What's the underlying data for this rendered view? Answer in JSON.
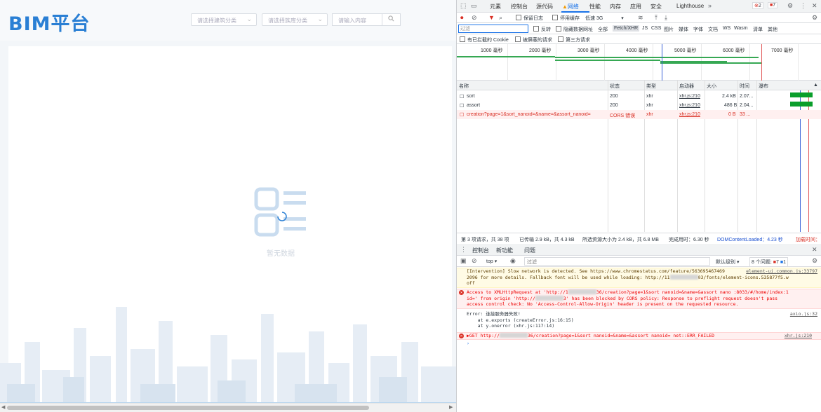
{
  "app": {
    "logo": "BIM平台",
    "select1_placeholder": "请选择建筑分类",
    "select2_placeholder": "请选择族库分类",
    "search_placeholder": "请输入内容",
    "empty_text": "暂无数据"
  },
  "devtools": {
    "tabs": [
      "元素",
      "控制台",
      "源代码",
      "网络",
      "性能",
      "内存",
      "应用",
      "安全",
      "Lighthouse"
    ],
    "error_count": "2",
    "warn_count": "7",
    "toolbar": {
      "preserve_log": "保留日志",
      "disable_cache": "停用缓存",
      "throttling": "低速 3G"
    },
    "filter": {
      "placeholder": "过滤",
      "invert": "反转",
      "hide_data_urls": "隐藏数据网址",
      "types": [
        "全部",
        "Fetch/XHR",
        "JS",
        "CSS",
        "图片",
        "媒体",
        "字体",
        "文档",
        "WS",
        "Wasm",
        "清单",
        "其他"
      ],
      "blocked_cookies": "有已拦截的 Cookie",
      "blocked_requests": "被屏蔽的请求",
      "third_party": "第三方请求"
    },
    "timeline_ticks": [
      "1000 毫秒",
      "2000 毫秒",
      "3000 毫秒",
      "4000 毫秒",
      "5000 毫秒",
      "6000 毫秒",
      "7000 毫秒"
    ],
    "columns": [
      "名称",
      "状态",
      "类型",
      "启动器",
      "大小",
      "时间",
      "瀑布"
    ],
    "requests": [
      {
        "name": "sort",
        "status": "200",
        "type": "xhr",
        "initiator": "xhr.js:210",
        "size": "2.4 kB",
        "time": "2.07...",
        "error": false
      },
      {
        "name": "assort",
        "status": "200",
        "type": "xhr",
        "initiator": "xhr.js:210",
        "size": "486 B",
        "time": "2.04...",
        "error": false
      },
      {
        "name": "creation?page=1&sort_nanoid=&name=&assort_nanoid=",
        "status": "CORS 错误",
        "type": "xhr",
        "initiator": "xhr.js:210",
        "size": "0 B",
        "time": "33 ...",
        "error": true
      }
    ],
    "summary": {
      "requests": "第 3 项请求，共 38 项",
      "transferred": "已传输 2.9 kB，共 4.3 kB",
      "resources": "所选资源大小为 2.4 kB，共 6.8 MB",
      "finish": "完成用时：6.30 秒",
      "dcl": "DOMContentLoaded：4.23 秒",
      "load": "加载时间："
    },
    "drawer_tabs": [
      "控制台",
      "新功能",
      "问题"
    ],
    "console_toolbar": {
      "context": "top",
      "filter_placeholder": "过滤",
      "levels": "默认级别",
      "issues": "8 个问题:",
      "issue_err": "7",
      "issue_info": "1"
    },
    "console_messages": {
      "warn_line1": "[Intervention] Slow network is detected. See https://www.chromestatus.com/feature/563695467469",
      "warn_line1_src": "element-ui.common.js:33797",
      "warn_line2": "2096 for more details. Fallback font will be used while loading: http://11",
      "warn_line2b": "03/fonts/element-icons.535877f5.w",
      "warn_line3": "off",
      "err1_line1": "Access to XMLHttpRequest at 'http://1",
      "err1_line1b": "36/creation?page=1&sort nanoid=&name=&assort nano :8033/#/home/index:1",
      "err1_line2": "id=' from origin 'http://",
      "err1_line2b": "3' has been blocked by CORS policy: Response to preflight request doesn't pass",
      "err1_line3": "access control check: No 'Access-Control-Allow-Origin' header is present on the requested resource.",
      "log_line1": "Error: 连接服务器失败!",
      "log_line1_src": "axio.js:32",
      "log_line2": "    at e.exports (createError.js:16:15)",
      "log_line3": "    at y.onerror (xhr.js:117:14)",
      "get_line": "▶GET http://",
      "get_line_b": "36/creation?page=1&sort nanoid=&name=&assort nanoid= net::ERR_FAILED",
      "get_src": "xhr.js:210",
      "prompt": "›"
    }
  }
}
